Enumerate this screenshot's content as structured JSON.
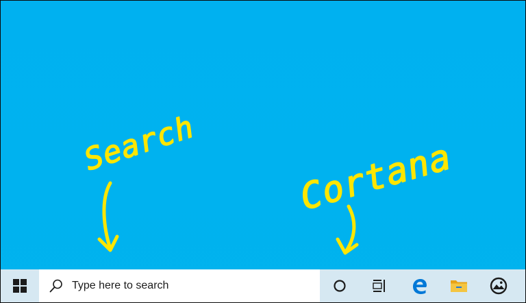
{
  "annotations": {
    "search_label": "Search",
    "cortana_label": "Cortana",
    "ink_color": "#ffe600"
  },
  "taskbar": {
    "start_icon": "windows-logo-icon",
    "search": {
      "icon": "magnifier-icon",
      "placeholder": "Type here to search"
    },
    "buttons": [
      {
        "name": "cortana-button",
        "icon": "cortana-ring-icon"
      },
      {
        "name": "task-view-button",
        "icon": "task-view-icon"
      },
      {
        "name": "edge-button",
        "icon": "edge-icon"
      },
      {
        "name": "file-explorer-button",
        "icon": "folder-icon"
      },
      {
        "name": "photos-button",
        "icon": "photos-icon"
      }
    ],
    "colors": {
      "taskbar": "#d6e8f2",
      "search_box": "#ffffff",
      "desktop": "#00b1f0",
      "edge_blue": "#0078d7",
      "folder_yellow": "#f4c542"
    }
  }
}
